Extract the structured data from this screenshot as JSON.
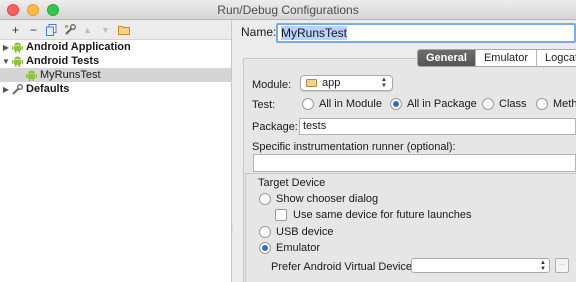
{
  "window": {
    "title": "Run/Debug Configurations"
  },
  "toolbar": {
    "buttons": [
      "add-icon",
      "remove-icon",
      "copy-icon",
      "edit-defaults-icon",
      "move-up-icon",
      "move-down-icon",
      "folder-icon"
    ],
    "add": "+",
    "remove": "−"
  },
  "tree": {
    "items": [
      {
        "label": "Android Application",
        "expanded": false,
        "depth": 0,
        "icon": "android-icon"
      },
      {
        "label": "Android Tests",
        "expanded": true,
        "depth": 0,
        "icon": "android-icon"
      },
      {
        "label": "MyRunsTest",
        "depth": 1,
        "selected": true,
        "icon": "android-icon"
      },
      {
        "label": "Defaults",
        "expanded": false,
        "depth": 0,
        "icon": "defaults-icon"
      }
    ]
  },
  "config": {
    "name_label": "Name:",
    "name_value": "MyRunsTest"
  },
  "tabs": [
    {
      "label": "General",
      "active": true
    },
    {
      "label": "Emulator",
      "active": false
    },
    {
      "label": "Logcat",
      "active": false
    }
  ],
  "general": {
    "module_label": "Module:",
    "module_value": "app",
    "test_label": "Test:",
    "test_options": [
      {
        "label": "All in Module",
        "selected": false
      },
      {
        "label": "All in Package",
        "selected": true
      },
      {
        "label": "Class",
        "selected": false
      },
      {
        "label": "Metho",
        "selected": false
      }
    ],
    "package_label": "Package:",
    "package_value": "tests",
    "runner_label": "Specific instrumentation runner (optional):",
    "runner_value": "",
    "target_device": {
      "title": "Target Device",
      "show_chooser": "Show chooser dialog",
      "same_device": "Use same device for future launches",
      "usb": "USB device",
      "emulator": "Emulator",
      "selected": "Emulator",
      "avd_label": "Prefer Android Virtual Device:",
      "avd_value": "",
      "avd_button": "···"
    }
  },
  "colors": {
    "android_green": "#8cc43e",
    "selection_blue": "#b6d3fc",
    "radio_blue": "#2f6bd8"
  }
}
